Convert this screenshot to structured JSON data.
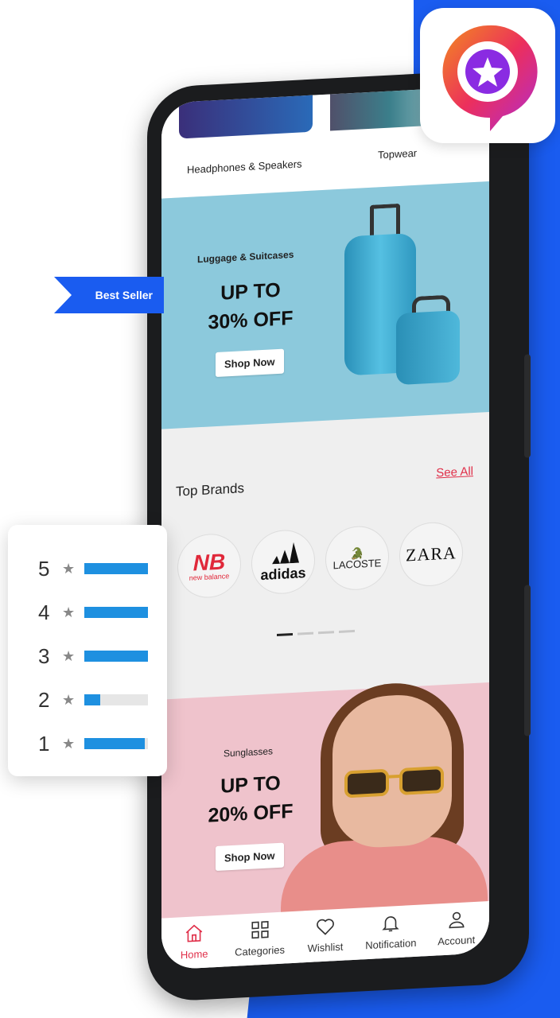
{
  "categories": {
    "left_label": "Headphones & Speakers",
    "right_label": "Topwear"
  },
  "luggage_banner": {
    "subtitle": "Luggage & Suitcases",
    "headline_line1": "UP TO",
    "headline_line2": "30% OFF",
    "button": "Shop Now",
    "background": "#8cc9dc"
  },
  "best_seller": "Best Seller",
  "brands": {
    "title": "Top Brands",
    "see_all": "See All",
    "items": [
      "new balance",
      "adidas",
      "LACOSTE",
      "ZARA"
    ],
    "carousel_active_index": 0,
    "carousel_count": 4
  },
  "sunglasses_banner": {
    "subtitle": "Sunglasses",
    "headline_line1": "UP TO",
    "headline_line2": "20% OFF",
    "button": "Shop Now",
    "background": "#efc3cc"
  },
  "tabs": [
    {
      "label": "Home",
      "icon": "home-icon",
      "active": true
    },
    {
      "label": "Categories",
      "icon": "grid-icon",
      "active": false
    },
    {
      "label": "Wishlist",
      "icon": "heart-icon",
      "active": false
    },
    {
      "label": "Notification",
      "icon": "bell-icon",
      "active": false
    },
    {
      "label": "Account",
      "icon": "user-icon",
      "active": false
    }
  ],
  "ratings": [
    {
      "stars": "5",
      "fill": 1.0
    },
    {
      "stars": "4",
      "fill": 1.0
    },
    {
      "stars": "3",
      "fill": 1.0
    },
    {
      "stars": "2",
      "fill": 0.25
    },
    {
      "stars": "1",
      "fill": 0.95
    }
  ],
  "colors": {
    "accent_blue": "#1a5cf0",
    "accent_red": "#e0304a",
    "rating_bar": "#1e90e0"
  }
}
